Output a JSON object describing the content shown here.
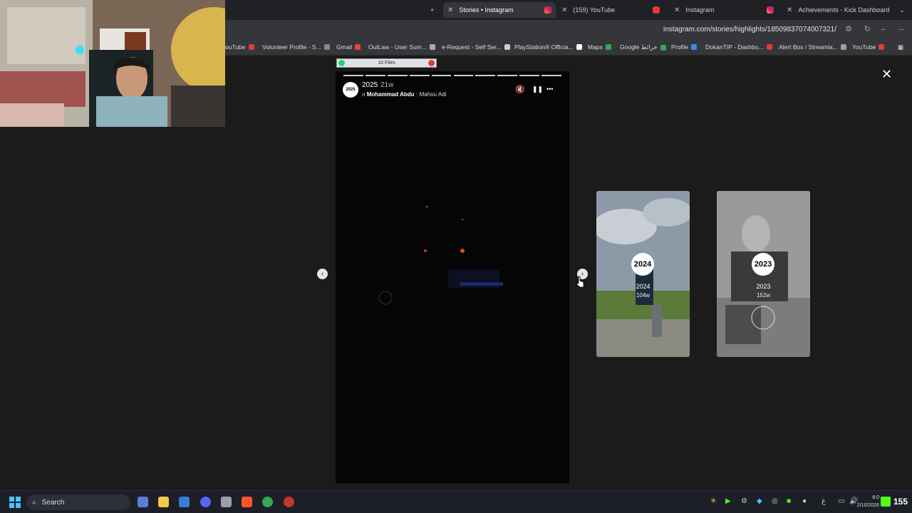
{
  "browser": {
    "tabs": [
      {
        "label": "Stories • Instagram",
        "icon": "instagram-icon",
        "active": true
      },
      {
        "label": "(159) YouTube",
        "icon": "youtube-icon"
      },
      {
        "label": "Instagram",
        "icon": "instagram-icon"
      },
      {
        "label": "Achievements - Kick Dashboard",
        "icon": "kick-icon"
      }
    ],
    "new_tab_symbol": "+",
    "url": "instagram.com/stories/highlights/18509837074007321/",
    "bookmarks": [
      {
        "label": "ouTube",
        "color": "#e53935"
      },
      {
        "label": "Volunteer Profile - S...",
        "color": "#888888"
      },
      {
        "label": "Gmail",
        "color": "#ea4335"
      },
      {
        "label": "OutLaw - User Sum...",
        "color": "#aaaaaa"
      },
      {
        "label": "e-Request - Self Ser...",
        "color": "#cccccc"
      },
      {
        "label": "PlayStation® Officia...",
        "color": "#ffffff"
      },
      {
        "label": "Maps",
        "color": "#34a853"
      },
      {
        "label": "Google خرائط",
        "color": "#34a853"
      },
      {
        "label": "Profile",
        "color": "#4285f4"
      },
      {
        "label": "DokanTIP - Dashbo...",
        "color": "#e53935"
      },
      {
        "label": "Alert Box / Streamla...",
        "color": "#9e9e9e"
      },
      {
        "label": "YouTube",
        "color": "#e53935"
      }
    ]
  },
  "files_bar": {
    "label": "10 Files"
  },
  "story": {
    "avatar_text": "2025",
    "title": "2025",
    "age": "21w",
    "music_artist": "Mohammad Abdu",
    "music_track": "· Mahou Adi",
    "progress_segments": 10
  },
  "previews": [
    {
      "badge": "2024",
      "title": "2024",
      "age": "104w"
    },
    {
      "badge": "2023",
      "title": "2023",
      "age": "152w"
    }
  ],
  "controls": {
    "close_symbol": "✕",
    "prev_symbol": "‹",
    "next_symbol": "›",
    "mute_symbol": "🔇",
    "pause_symbol": "❚❚",
    "more_symbol": "•••"
  },
  "taskbar": {
    "search_label": "Search",
    "clock_time": "8:0",
    "clock_date": "2/10/2026",
    "lang": "ع",
    "counter": "155"
  },
  "colors": {
    "kick": "#53fc18",
    "instagram": "#e1306c",
    "youtube": "#e53935"
  }
}
